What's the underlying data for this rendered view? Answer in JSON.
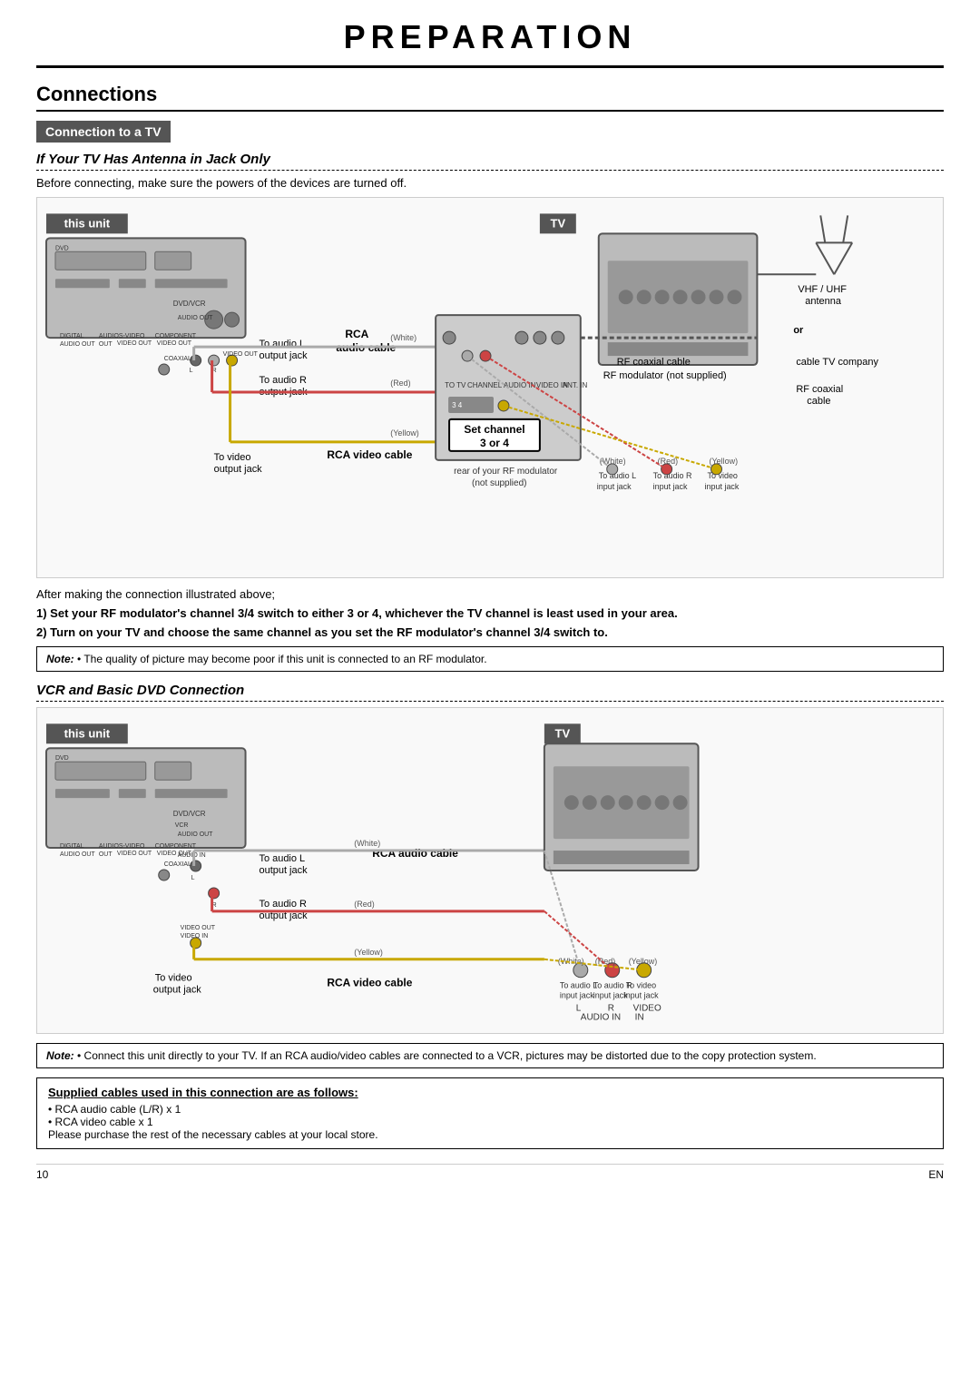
{
  "page": {
    "title": "PREPARATION",
    "section_title": "Connections",
    "subsection_label": "Connection to a TV",
    "section1_title": "If Your TV Has Antenna in Jack Only",
    "section2_title": "VCR and Basic DVD Connection",
    "intro_text": "Before connecting, make sure the powers of the devices are turned off.",
    "after_connection_text": "After making the connection illustrated above;",
    "instruction1": "1) Set your RF modulator's channel 3/4 switch to either 3 or 4, whichever the TV channel is least used in your area.",
    "instruction2": "2) Turn on your TV and choose the same channel as you set the RF modulator's channel 3/4 switch to.",
    "note1_label": "Note:",
    "note1_text": "• The quality of picture may become poor if this unit is connected to an RF modulator.",
    "note2_label": "Note:",
    "note2_text": "• Connect this unit directly to your TV. If an RCA audio/video cables are connected to a VCR, pictures may be distorted due to the copy protection system.",
    "this_unit_label": "this unit",
    "tv_label": "TV",
    "set_channel_line1": "Set channel",
    "set_channel_line2": "3 or 4",
    "vhf_uhf": "VHF / UHF",
    "antenna": "antenna",
    "cable_tv": "cable TV company",
    "rf_coaxial_cable": "RF coaxial cable",
    "rf_coaxial_label": "RF coaxial cable",
    "rf_modulator": "RF modulator (not supplied)",
    "to_audio_l": "To audio L",
    "output_jack": "output jack",
    "to_audio_r": "To audio R",
    "output_jack2": "output jack",
    "to_video": "To video",
    "output_jack3": "output jack",
    "rca_audio_cable": "RCA audio cable",
    "rca_video_cable": "RCA video cable",
    "white_label": "(White)",
    "red_label": "(Red)",
    "yellow_label": "(Yellow)",
    "rear_rf": "rear of your RF modulator",
    "not_supplied": "(not supplied)",
    "channel_label": "CHANNEL",
    "digital_audio_out": "DIGITAL\nAUDIO OUT",
    "audio_out": "AUDIO\nOUT",
    "s_video": "S-VIDEO\nVIDEO OUT",
    "component": "COMPONENT\nVIDEO OUT",
    "dvd_vcr_label": "DVD/VCR",
    "audio_out_label": "AUDIO OUT",
    "coaxial_label": "COAXIAL",
    "to_audio_l_input": "To audio L\ninput jack",
    "to_audio_r_input": "To audio R\ninput jack",
    "to_video_input": "To video\ninput jack",
    "audio_in_label": "AUDIO IN",
    "video_in_label": "IN",
    "l_label": "L",
    "r_label": "R",
    "video_label": "VIDEO",
    "supplied_title": "Supplied cables used in this connection are as follows:",
    "supplied_items": [
      "• RCA audio cable (L/R) x 1",
      "• RCA video cable x 1",
      "Please purchase the rest of the necessary cables at your local store."
    ],
    "page_number": "10",
    "en_label": "EN",
    "or_label": "or"
  }
}
